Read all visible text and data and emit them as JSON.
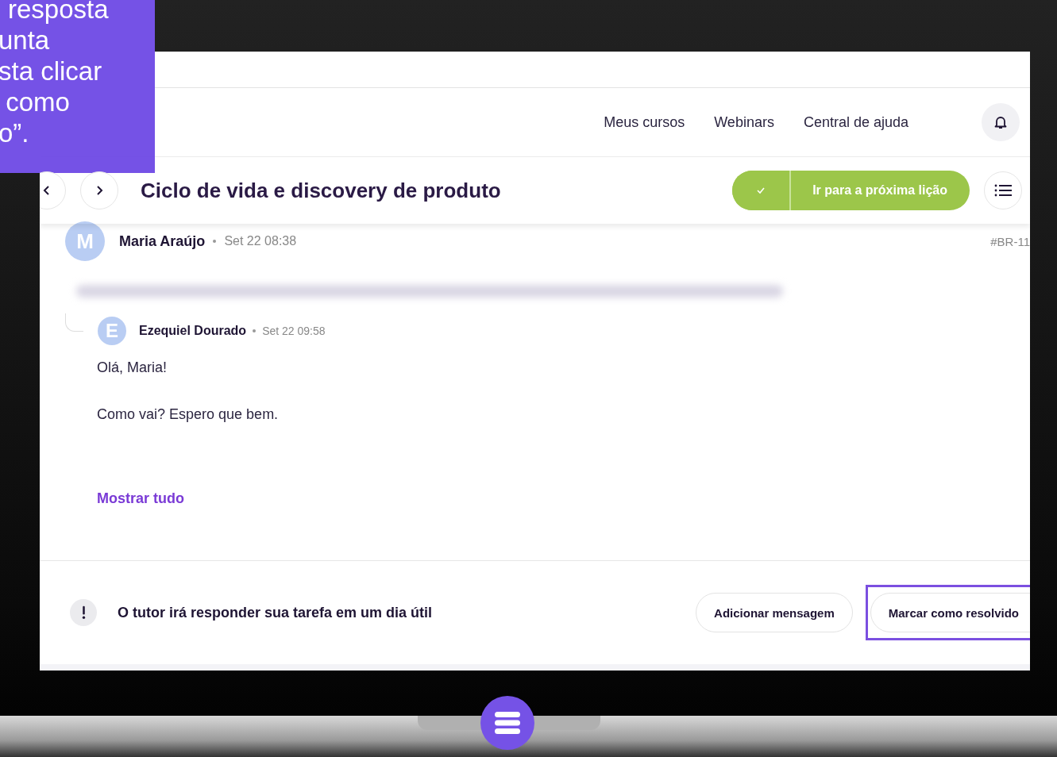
{
  "overlay": {
    "lines": [
      "resposta",
      "unta",
      "sta clicar",
      " como",
      "o”."
    ]
  },
  "nav": {
    "links": [
      "Meus cursos",
      "Webinars",
      "Central de ajuda"
    ]
  },
  "lesson": {
    "title": "Ciclo de vida e discovery de produto",
    "completed": true,
    "next_button": "Ir para a próxima lição"
  },
  "comment": {
    "avatar": "M",
    "author": "Maria Araújo",
    "date": "Set 22 08:38",
    "ticket": "#BR-11",
    "reply": {
      "avatar": "E",
      "author": "Ezequiel Dourado",
      "date": "Set 22 09:58",
      "paragraphs": [
        "Olá, Maria!",
        "Como vai? Espero que bem."
      ],
      "show_all": "Mostrar tudo"
    }
  },
  "footer": {
    "notice": "O tutor irá responder sua tarefa em um dia útil",
    "buttons": [
      {
        "label": "Adicionar mensagem",
        "highlighted": false
      },
      {
        "label": "Marcar como resolvido",
        "highlighted": true
      }
    ]
  }
}
